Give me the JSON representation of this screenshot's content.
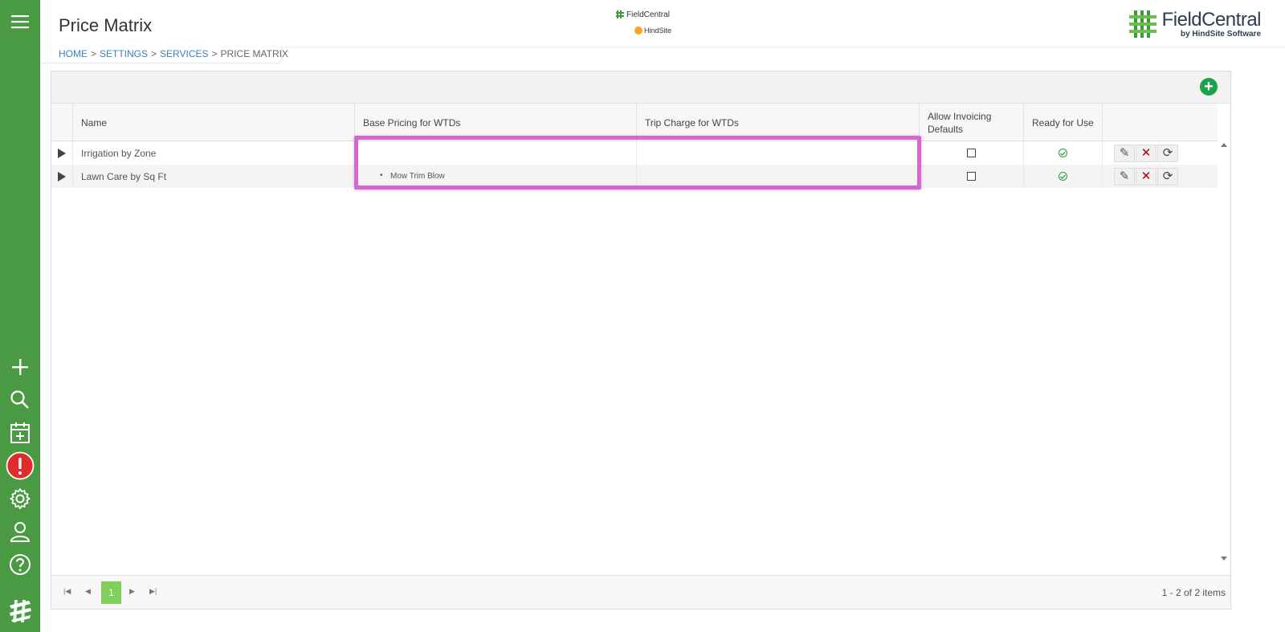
{
  "header": {
    "title": "Price Matrix",
    "center_logo_brand": "FieldCentral",
    "center_logo_sub": "HindSite",
    "right_logo_name": "FieldCentral",
    "right_logo_by": "by HindSite Software"
  },
  "breadcrumb": {
    "home": "HOME",
    "settings": "SETTINGS",
    "services": "SERVICES",
    "current": "PRICE MATRIX",
    "separator": ">"
  },
  "sidebar": {
    "icons": [
      "menu-icon",
      "plus-icon",
      "search-icon",
      "calendar-add-icon",
      "alert-icon",
      "gear-icon",
      "user-icon",
      "help-icon",
      "brand-icon"
    ]
  },
  "table": {
    "columns": [
      "",
      "Name",
      "Base Pricing for WTDs",
      "Trip Charge for WTDs",
      "Allow Invoicing Defaults",
      "Ready for Use",
      ""
    ],
    "rows": [
      {
        "name": "Irrigation by Zone",
        "base_pricing": "",
        "trip_charge": "",
        "allow_invoicing": false,
        "ready": true
      },
      {
        "name": "Lawn Care by Sq Ft",
        "base_pricing": "Mow Trim Blow",
        "trip_charge": "",
        "allow_invoicing": false,
        "ready": true
      }
    ]
  },
  "pager": {
    "current_page": "1",
    "info": "1 - 2 of 2 items"
  },
  "colors": {
    "sidebar": "#4a9a43",
    "accent_green": "#1aa34a",
    "highlight": "#d665d6",
    "page_active": "#7fcf5a",
    "delete_red": "#b50000"
  }
}
